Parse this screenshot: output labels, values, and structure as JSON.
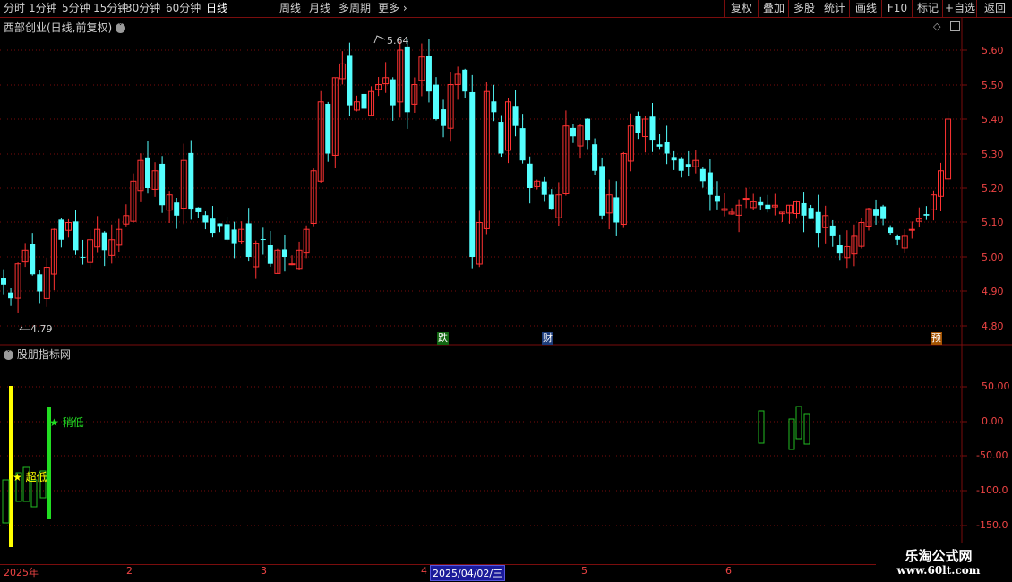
{
  "toolbar": {
    "periods": [
      "分时",
      "1分钟",
      "5分钟",
      "15分钟",
      "30分钟",
      "60分钟",
      "日线",
      "周线",
      "月线",
      "多周期",
      "更多"
    ],
    "active_period": "日线",
    "right_buttons": [
      "复权",
      "叠加",
      "多股",
      "统计",
      "画线",
      "F10",
      "标记",
      "+自选",
      "返回"
    ]
  },
  "main_panel": {
    "title": "西部创业(日线,前复权)",
    "y_labels": [
      "5.60",
      "5.50",
      "5.40",
      "5.30",
      "5.20",
      "5.10",
      "5.00",
      "4.90",
      "4.80"
    ],
    "high_label": "5.64",
    "low_label": "4.79",
    "event_tags": [
      {
        "text": "跌",
        "color": "#22aa22"
      },
      {
        "text": "财",
        "color": "#3366cc"
      },
      {
        "text": "预",
        "color": "#cc6600"
      }
    ]
  },
  "sub_panel": {
    "title": "股朋指标网",
    "y_labels": [
      "50.00",
      "0.00",
      "-50.00",
      "-100.0",
      "-150.0"
    ],
    "signal_yellow": "★ 超低",
    "signal_green": "★ 稍低"
  },
  "date_axis": {
    "labels": [
      "2025年",
      "2",
      "3",
      "4",
      "2025/04/02/三",
      "5",
      "6"
    ]
  },
  "watermark": {
    "line1": "乐淘公式网",
    "line2": "www.60lt.com"
  },
  "colors": {
    "up": "#ff3232",
    "down": "#54ffff",
    "grid": "#7a0d0d",
    "axis_text": "#ee4444"
  }
}
